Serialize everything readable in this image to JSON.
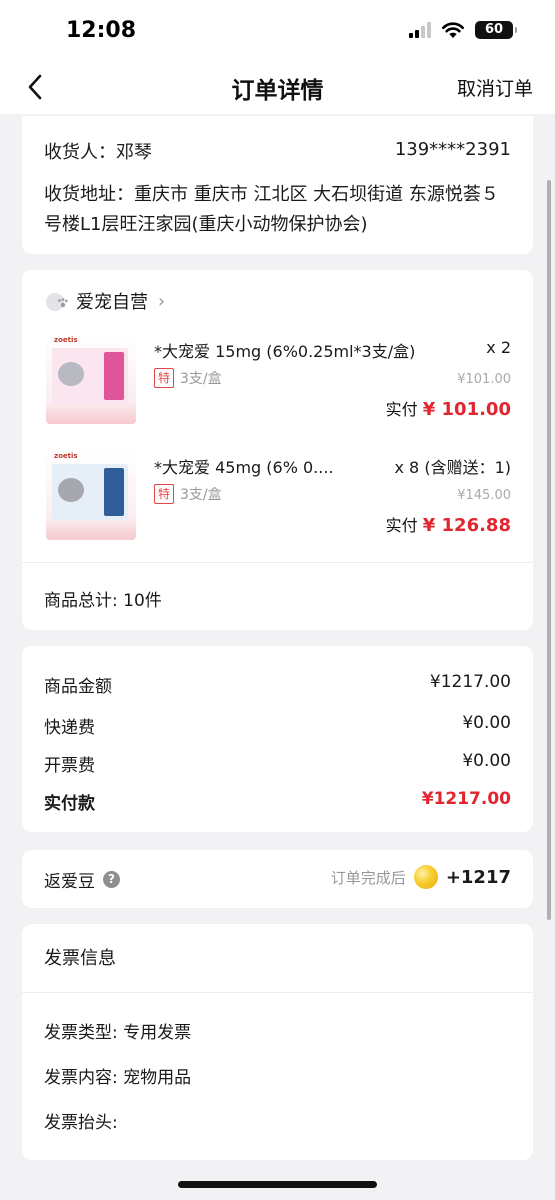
{
  "status_bar": {
    "time": "12:08",
    "battery": "60"
  },
  "nav": {
    "title": "订单详情",
    "cancel_label": "取消订单"
  },
  "address": {
    "recipient": "收货人：邓琴",
    "phone": "139****2391",
    "detail": "收货地址：重庆市 重庆市 江北区 大石坝街道 东源悦荟５号楼L1层旺汪家园(重庆小动物保护协会)"
  },
  "store": {
    "name": "爱宠自营"
  },
  "items": [
    {
      "brand": "zoetis",
      "title": "*大宠爱 15mg (6%0.25ml*3支/盒)",
      "qty": "x 2",
      "tag": "特",
      "spec": "3支/盒",
      "orig_price": "¥101.00",
      "paid_label": "实付",
      "paid_price": "¥ 101.00",
      "package_color": "#e0559a"
    },
    {
      "brand": "zoetis",
      "title": "*大宠爱 45mg (6% 0....",
      "qty": "x 8 (含赠送：1)",
      "tag": "特",
      "spec": "3支/盒",
      "orig_price": "¥145.00",
      "paid_label": "实付",
      "paid_price": "¥ 126.88",
      "package_color": "#2f5d9a"
    }
  ],
  "goods_total": "商品总计: 10件",
  "amounts": {
    "goods_label": "商品金额",
    "goods_value": "¥1217.00",
    "shipping_label": "快递费",
    "shipping_value": "¥0.00",
    "invoice_fee_label": "开票费",
    "invoice_fee_value": "¥0.00",
    "paid_label": "实付款",
    "paid_value": "¥1217.00"
  },
  "beans": {
    "label": "返爱豆",
    "note": "订单完成后",
    "count": "+1217"
  },
  "invoice": {
    "title": "发票信息",
    "type": "发票类型: 专用发票",
    "content": "发票内容: 宠物用品",
    "header": "发票抬头:"
  },
  "colors": {
    "accent_red": "#e0262f",
    "background": "#f2f2f4"
  }
}
